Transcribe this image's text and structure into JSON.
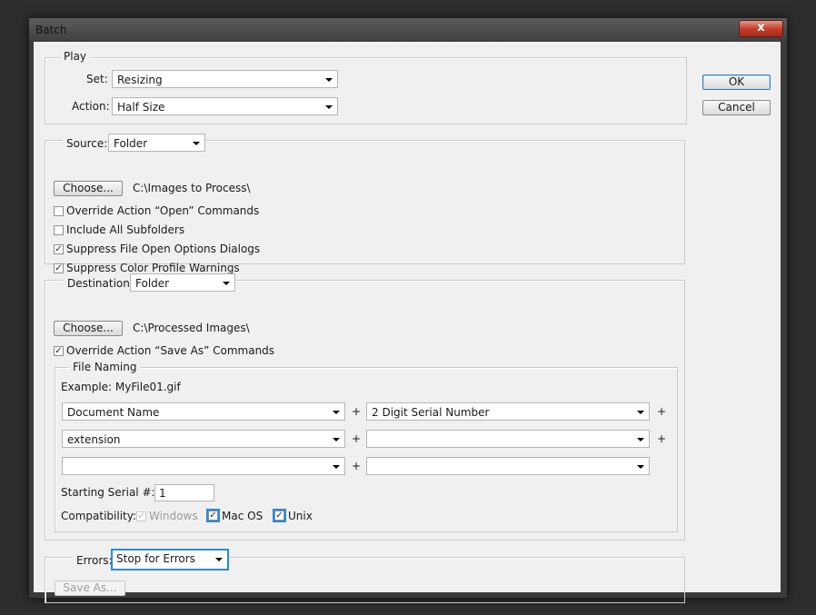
{
  "window": {
    "title": "Batch",
    "close_glyph": "x"
  },
  "buttons": {
    "ok": "OK",
    "cancel": "Cancel"
  },
  "play": {
    "legend": "Play",
    "set_label": "Set:",
    "set_value": "Resizing",
    "action_label": "Action:",
    "action_value": "Half Size"
  },
  "source": {
    "label": "Source:",
    "value": "Folder",
    "choose": "Choose...",
    "path": "C:\\Images to Process\\",
    "checkboxes": [
      {
        "label": "Override Action “Open” Commands",
        "checked": false
      },
      {
        "label": "Include All Subfolders",
        "checked": false
      },
      {
        "label": "Suppress File Open Options Dialogs",
        "checked": true
      },
      {
        "label": "Suppress Color Profile Warnings",
        "checked": true
      }
    ]
  },
  "destination": {
    "label": "Destination:",
    "value": "Folder",
    "choose": "Choose...",
    "path": "C:\\Processed Images\\",
    "override": {
      "label": "Override Action “Save As” Commands",
      "checked": true
    }
  },
  "file_naming": {
    "legend": "File Naming",
    "example": "Example: MyFile01.gif",
    "fields": [
      "Document Name",
      "2 Digit Serial Number",
      "extension",
      "",
      "",
      ""
    ],
    "plus": "+",
    "serial_label": "Starting Serial #:",
    "serial_value": "1",
    "compat_label": "Compatibility:",
    "compat": [
      {
        "label": "Windows",
        "checked": true,
        "disabled": true
      },
      {
        "label": "Mac OS",
        "checked": true,
        "disabled": false
      },
      {
        "label": "Unix",
        "checked": true,
        "disabled": false
      }
    ]
  },
  "errors": {
    "label": "Errors:",
    "value": "Stop for Errors",
    "save_as": "Save As..."
  },
  "check_glyph": "✓"
}
